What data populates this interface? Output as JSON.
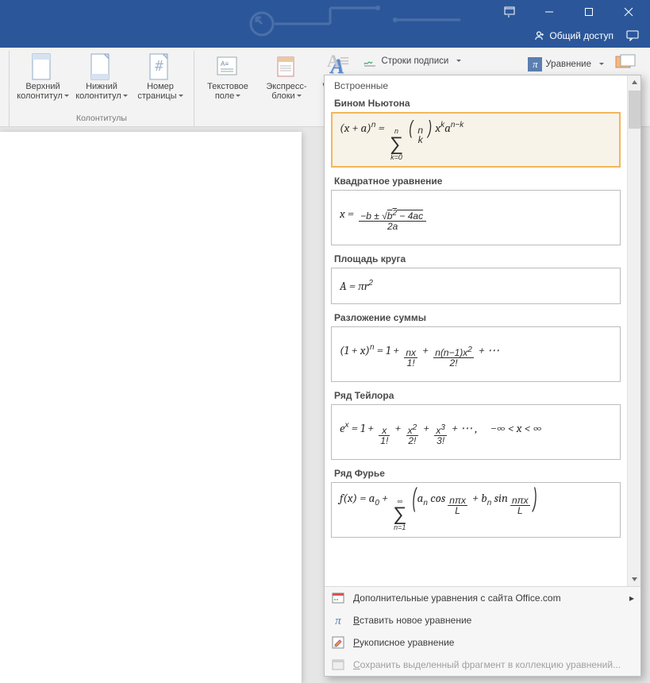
{
  "window": {
    "share": "Общий доступ"
  },
  "ribbon": {
    "hdrFooter": {
      "header": "Верхний\nколонтитул",
      "footer": "Нижний\nколонтитул",
      "pagenum": "Номер\nстраницы",
      "group": "Колонтитулы"
    },
    "text": {
      "textbox": "Текстовое\nполе",
      "quick": "Экспресс-\nблоки",
      "wordart": "WordAr"
    },
    "extra": {
      "sigline": "Строки подписи",
      "equation": "Уравнение"
    }
  },
  "gallery": {
    "header": "Встроенные",
    "items": [
      {
        "title": "Бином Ньютона"
      },
      {
        "title": "Квадратное уравнение"
      },
      {
        "title": "Площадь круга"
      },
      {
        "title": "Разложение суммы"
      },
      {
        "title": "Ряд Тейлора"
      },
      {
        "title": "Ряд Фурье"
      }
    ],
    "footer": {
      "more": "Дополнительные уравнения с сайта Office.com",
      "insert": "Вставить новое уравнение",
      "ink": "Рукописное уравнение",
      "save": "Сохранить выделенный фрагмент в коллекцию уравнений..."
    }
  }
}
